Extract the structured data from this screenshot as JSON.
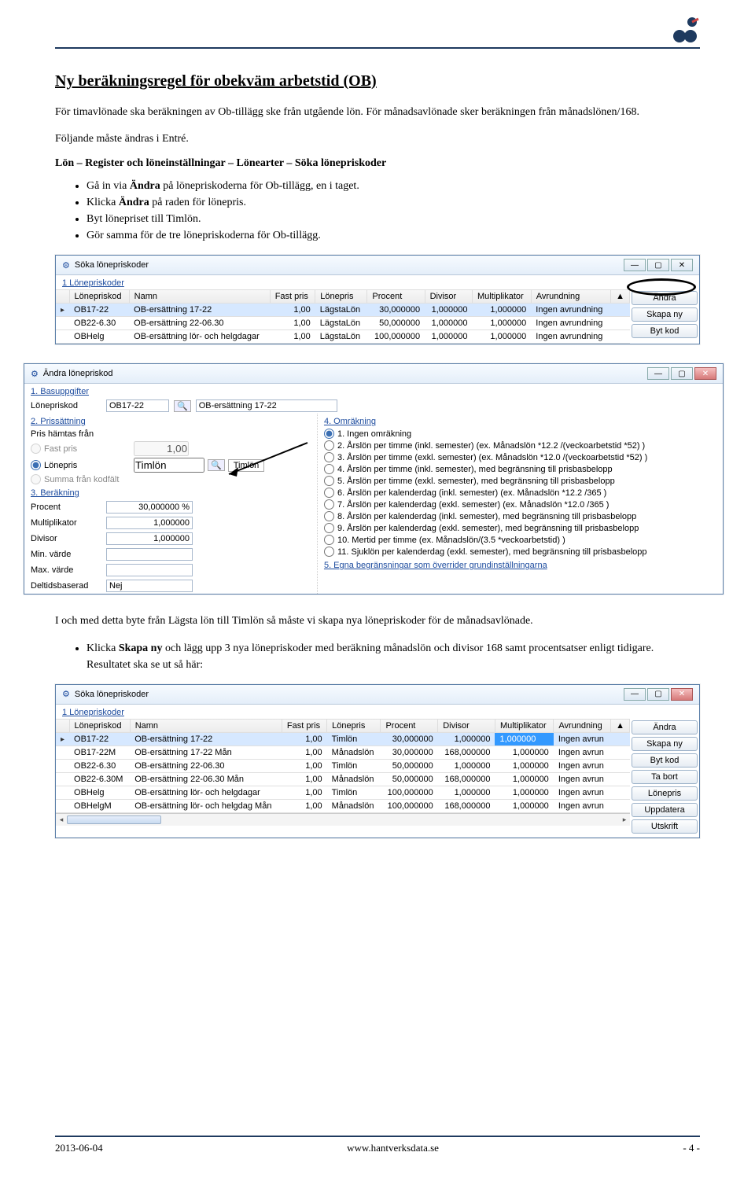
{
  "doc": {
    "heading": "Ny beräkningsregel för obekväm arbetstid (OB)",
    "p1": "För timavlönade ska beräkningen av Ob-tillägg ske från utgående lön. För månadsavlönade sker beräkningen från månadslönen/168.",
    "p2": "Följande måste ändras i Entré.",
    "path": "Lön – Register och löneinställningar – Lönearter – Söka lönepriskoder",
    "b1a": "Gå in via ",
    "b1b": "Ändra",
    "b1c": " på lönepriskoderna för Ob-tillägg, en i taget.",
    "b2a": "Klicka ",
    "b2b": "Ändra",
    "b2c": " på raden för lönepris.",
    "b3": "Byt lönepriset till Timlön.",
    "b4": "Gör samma för de tre lönepriskoderna för Ob-tillägg.",
    "mid": "I och med detta byte från Lägsta lön till Timlön så måste vi skapa nya lönepriskoder för de månadsavlönade.",
    "b5a": "Klicka ",
    "b5b": "Skapa ny",
    "b5c": " och lägg upp 3 nya lönepriskoder med beräkning månadslön och divisor 168 samt procentsatser enligt tidigare. Resultatet ska se ut så här:"
  },
  "win1": {
    "title": "Söka lönepriskoder",
    "section": "1 Lönepriskoder",
    "headers": [
      "Lönepriskod",
      "Namn",
      "Fast pris",
      "Lönepris",
      "Procent",
      "Divisor",
      "Multiplikator",
      "Avrundning"
    ],
    "rows": [
      {
        "kod": "OB17-22",
        "namn": "OB-ersättning 17-22",
        "fast": "1,00",
        "lonepris": "LägstaLön",
        "procent": "30,000000",
        "divisor": "1,000000",
        "mult": "1,000000",
        "avr": "Ingen avrundning",
        "sel": true
      },
      {
        "kod": "OB22-6.30",
        "namn": "OB-ersättning 22-06.30",
        "fast": "1,00",
        "lonepris": "LägstaLön",
        "procent": "50,000000",
        "divisor": "1,000000",
        "mult": "1,000000",
        "avr": "Ingen avrundning"
      },
      {
        "kod": "OBHelg",
        "namn": "OB-ersättning lör- och helgdagar",
        "fast": "1,00",
        "lonepris": "LägstaLön",
        "procent": "100,000000",
        "divisor": "1,000000",
        "mult": "1,000000",
        "avr": "Ingen avrundning"
      }
    ],
    "buttons": {
      "andra": "Ändra",
      "skapany": "Skapa ny",
      "bytkod": "Byt kod"
    }
  },
  "win2": {
    "title": "Ändra lönepriskod",
    "g1": "1. Basuppgifter",
    "g2": "2. Prissättning",
    "g3": "3. Beräkning",
    "g4": "4. Omräkning",
    "g5": "5. Egna begränsningar som överrider grundinställningarna",
    "lonepriskod_label": "Lönepriskod",
    "lonepriskod": "OB17-22",
    "lonepriskod_name": "OB-ersättning 17-22",
    "pris_hamtas": "Pris hämtas från",
    "fast_pris_label": "Fast pris",
    "fast_pris": "1,00",
    "lonepris_label": "Lönepris",
    "lonepris": "Timlön",
    "summa_label": "Summa från kodfält",
    "procent_label": "Procent",
    "procent": "30,000000 %",
    "mult_label": "Multiplikator",
    "mult": "1,000000",
    "div_label": "Divisor",
    "div": "1,000000",
    "min_label": "Min. värde",
    "min": "",
    "max_label": "Max. värde",
    "max": "",
    "deltid_label": "Deltidsbaserad",
    "deltid": "Nej",
    "omrakning": [
      "1. Ingen omräkning",
      "2. Årslön per timme (inkl. semester)  (ex. Månadslön *12.2 /(veckoarbetstid *52) )",
      "3. Årslön per timme (exkl. semester)  (ex. Månadslön *12.0 /(veckoarbetstid *52) )",
      "4. Årslön per timme (inkl. semester), med begränsning till prisbasbelopp",
      "5. Årslön per timme (exkl. semester), med begränsning till prisbasbelopp",
      "6. Årslön per kalenderdag (inkl. semester)  (ex. Månadslön *12.2 /365 )",
      "7. Årslön per kalenderdag (exkl. semester)  (ex. Månadslön *12.0 /365 )",
      "8. Årslön per kalenderdag (inkl. semester), med begränsning till prisbasbelopp",
      "9. Årslön per kalenderdag (exkl. semester), med begränsning till prisbasbelopp",
      "10. Mertid per timme (ex. Månadslön/(3.5 *veckoarbetstid) )",
      "11. Sjuklön per kalenderdag (exkl. semester), med begränsning till prisbasbelopp"
    ]
  },
  "win3": {
    "title": "Söka lönepriskoder",
    "section": "1 Lönepriskoder",
    "headers": [
      "Lönepriskod",
      "Namn",
      "Fast pris",
      "Lönepris",
      "Procent",
      "Divisor",
      "Multiplikator",
      "Avrundning"
    ],
    "rows": [
      {
        "kod": "OB17-22",
        "namn": "OB-ersättning 17-22",
        "fast": "1,00",
        "lonepris": "Timlön",
        "procent": "30,000000",
        "divisor": "1,000000",
        "mult": "1,000000",
        "avr": "Ingen avrun",
        "sel": true,
        "hl": true
      },
      {
        "kod": "OB17-22M",
        "namn": "OB-ersättning 17-22 Mån",
        "fast": "1,00",
        "lonepris": "Månadslön",
        "procent": "30,000000",
        "divisor": "168,000000",
        "mult": "1,000000",
        "avr": "Ingen avrun"
      },
      {
        "kod": "OB22-6.30",
        "namn": "OB-ersättning 22-06.30",
        "fast": "1,00",
        "lonepris": "Timlön",
        "procent": "50,000000",
        "divisor": "1,000000",
        "mult": "1,000000",
        "avr": "Ingen avrun"
      },
      {
        "kod": "OB22-6.30M",
        "namn": "OB-ersättning 22-06.30  Mån",
        "fast": "1,00",
        "lonepris": "Månadslön",
        "procent": "50,000000",
        "divisor": "168,000000",
        "mult": "1,000000",
        "avr": "Ingen avrun"
      },
      {
        "kod": "OBHelg",
        "namn": "OB-ersättning lör- och helgdagar",
        "fast": "1,00",
        "lonepris": "Timlön",
        "procent": "100,000000",
        "divisor": "1,000000",
        "mult": "1,000000",
        "avr": "Ingen avrun"
      },
      {
        "kod": "OBHelgM",
        "namn": "OB-ersättning lör- och helgdag Mån",
        "fast": "1,00",
        "lonepris": "Månadslön",
        "procent": "100,000000",
        "divisor": "168,000000",
        "mult": "1,000000",
        "avr": "Ingen avrun"
      }
    ],
    "buttons": {
      "andra": "Ändra",
      "skapany": "Skapa ny",
      "bytkod": "Byt kod",
      "tabort": "Ta bort",
      "lonepris": "Lönepris",
      "uppdatera": "Uppdatera",
      "utskrift": "Utskrift"
    }
  },
  "footer": {
    "date": "2013-06-04",
    "url": "www.hantverksdata.se",
    "page": "- 4 -"
  }
}
